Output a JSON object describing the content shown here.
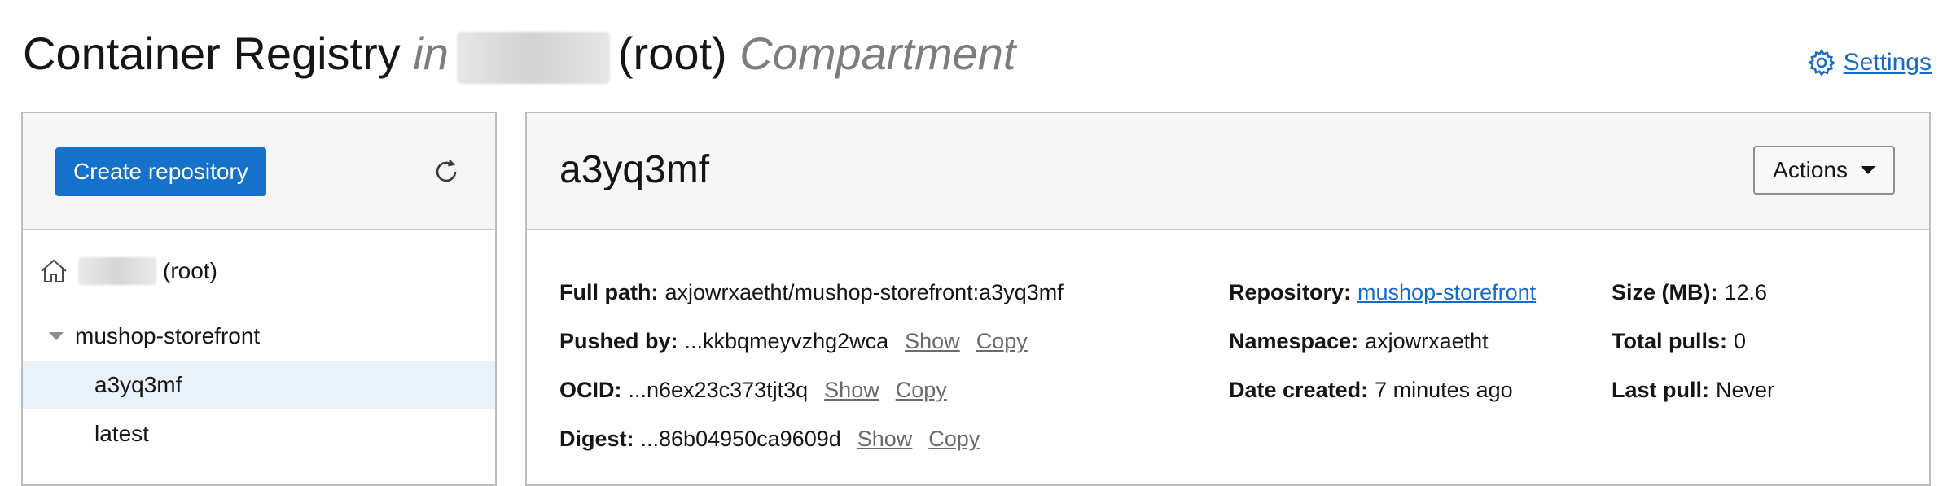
{
  "header": {
    "title_main": "Container Registry",
    "title_in": "in",
    "title_root": "(root)",
    "title_compartment": "Compartment",
    "settings_label": "Settings"
  },
  "left_panel": {
    "create_button": "Create repository",
    "root_label": "(root)",
    "repository": "mushop-storefront",
    "tags": [
      "a3yq3mf",
      "latest"
    ]
  },
  "detail": {
    "title": "a3yq3mf",
    "actions_label": "Actions",
    "full_path_label": "Full path:",
    "full_path_value": "axjowrxaetht/mushop-storefront:a3yq3mf",
    "pushed_by_label": "Pushed by:",
    "pushed_by_value": "...kkbqmeyvzhg2wca",
    "ocid_label": "OCID:",
    "ocid_value": "...n6ex23c373tjt3q",
    "digest_label": "Digest:",
    "digest_value": "...86b04950ca9609d",
    "show_label": "Show",
    "copy_label": "Copy",
    "repository_label": "Repository:",
    "repository_value": "mushop-storefront",
    "namespace_label": "Namespace:",
    "namespace_value": "axjowrxaetht",
    "date_created_label": "Date created:",
    "date_created_value": "7 minutes ago",
    "size_label": "Size (MB):",
    "size_value": "12.6",
    "total_pulls_label": "Total pulls:",
    "total_pulls_value": "0",
    "last_pull_label": "Last pull:",
    "last_pull_value": "Never"
  },
  "colors": {
    "primary": "#1671cb",
    "link": "#1969c8",
    "selected_row": "#e8f2fb"
  }
}
